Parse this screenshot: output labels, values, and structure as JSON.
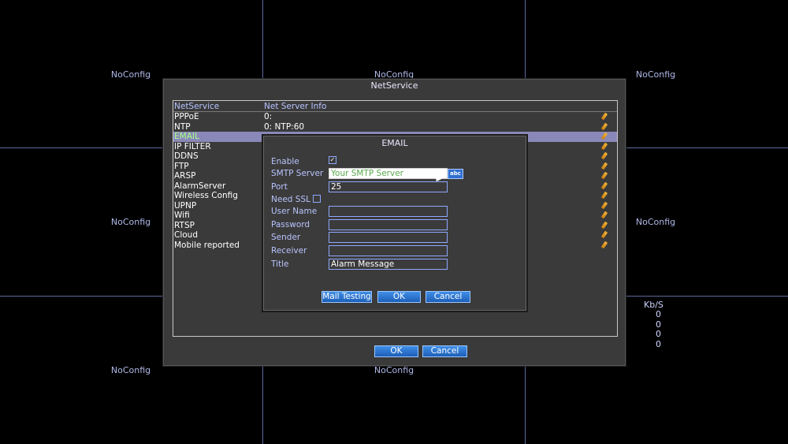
{
  "grid": {
    "cells": [
      "NoConfig",
      "NoConfig",
      "NoConfig",
      "NoConfig",
      "NoConfig",
      "NoConfig",
      "NoConfig",
      "NoConfig"
    ]
  },
  "bitrate": {
    "header": "Kb/S",
    "values": [
      "0",
      "0",
      "0",
      "0"
    ]
  },
  "netservice": {
    "title": "NetService",
    "columns": [
      "NetService",
      "Net Server Info"
    ],
    "rows": [
      {
        "name": "PPPoE",
        "info": "0:"
      },
      {
        "name": "NTP",
        "info": "0: NTP:60"
      },
      {
        "name": "EMAIL",
        "info": ""
      },
      {
        "name": "IP FILTER",
        "info": ""
      },
      {
        "name": "DDNS",
        "info": ""
      },
      {
        "name": "FTP",
        "info": ""
      },
      {
        "name": "ARSP",
        "info": ""
      },
      {
        "name": "AlarmServer",
        "info": ""
      },
      {
        "name": "Wireless Config",
        "info": ""
      },
      {
        "name": "UPNP",
        "info": ""
      },
      {
        "name": "Wifi",
        "info": ""
      },
      {
        "name": "RTSP",
        "info": ""
      },
      {
        "name": "Cloud",
        "info": ""
      },
      {
        "name": "Mobile reported",
        "info": ""
      }
    ],
    "ok_label": "OK",
    "cancel_label": "Cancel"
  },
  "email_dialog": {
    "title": "EMAIL",
    "labels": {
      "enable": "Enable",
      "smtp_server": "SMTP Server",
      "port": "Port",
      "need_ssl": "Need SSL",
      "user_name": "User Name",
      "password": "Password",
      "sender": "Sender",
      "receiver": "Receiver",
      "title": "Title"
    },
    "values": {
      "enable_checked": true,
      "smtp_server": "Your SMTP Server",
      "port": "25",
      "need_ssl_checked": false,
      "user_name": "",
      "password": "",
      "sender": "",
      "receiver": "",
      "title": "Alarm Message"
    },
    "keyboard_button": "abc",
    "mail_testing_label": "Mail Testing",
    "ok_label": "OK",
    "cancel_label": "Cancel"
  }
}
